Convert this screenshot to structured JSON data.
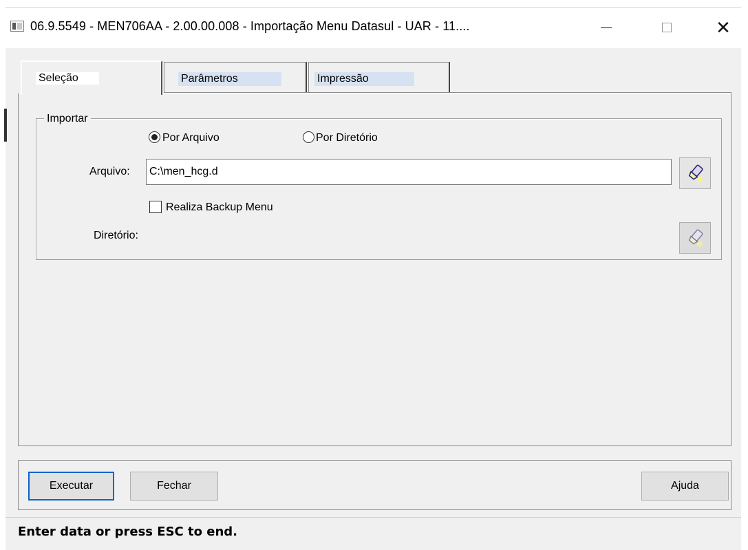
{
  "window": {
    "title": "06.9.5549 - MEN706AA - 2.00.00.008 - Importação Menu Datasul - UAR - 11....",
    "minimize_icon": "minimize-icon",
    "maximize_icon": "maximize-icon",
    "close_glyph": "✕"
  },
  "tabs": [
    {
      "label": "Seleção",
      "active": true
    },
    {
      "label": "Parâmetros",
      "active": false
    },
    {
      "label": "Impressão",
      "active": false
    }
  ],
  "importar": {
    "legend": "Importar",
    "radio_arquivo_label": "Por Arquivo",
    "radio_diretorio_label": "Por Diretório",
    "selected": "Por Arquivo",
    "arquivo_label": "Arquivo:",
    "arquivo_value": "C:\\men_hcg.d",
    "backup_label": "Realiza Backup Menu",
    "backup_checked": false,
    "diretorio_label": "Diretório:",
    "browse_icon": "flashlight-icon"
  },
  "buttons": {
    "executar": "Executar",
    "fechar": "Fechar",
    "ajuda": "Ajuda"
  },
  "status": {
    "text": "Enter data or press ESC to end."
  }
}
